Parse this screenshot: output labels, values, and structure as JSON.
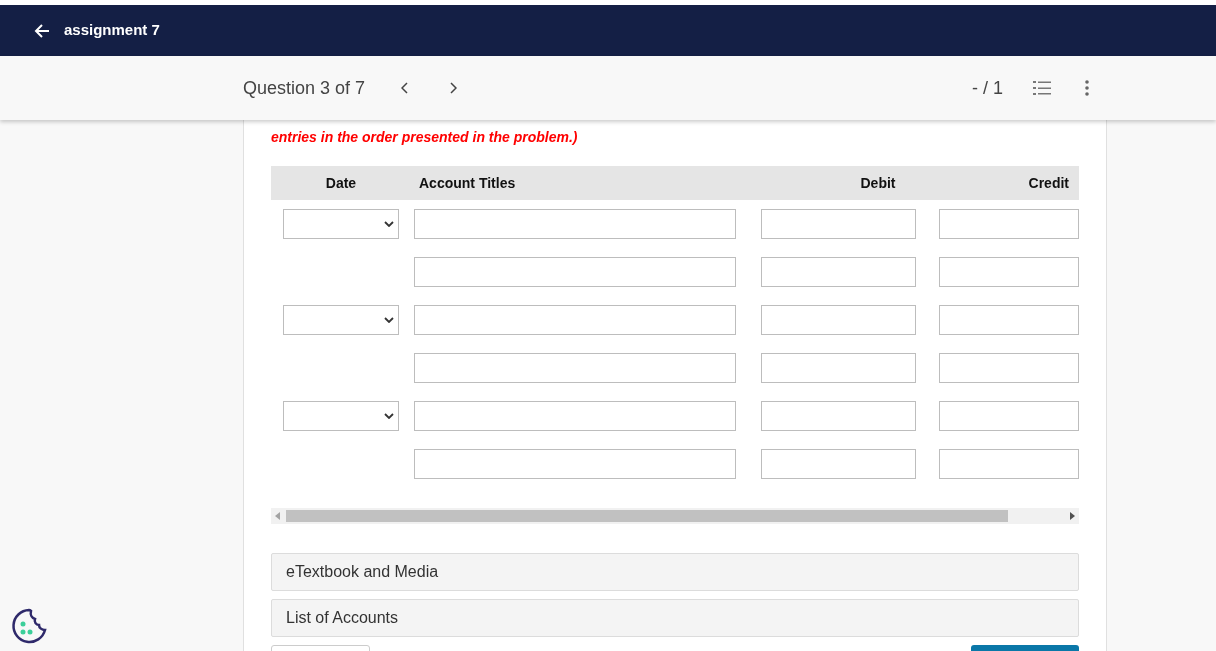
{
  "top_bar": {
    "title": "assignment 7"
  },
  "question_bar": {
    "title": "Question 3 of 7",
    "score": "- / 1"
  },
  "instruction": "entries in the order presented in the problem.)",
  "table": {
    "columns": [
      "Date",
      "Account Titles",
      "Debit",
      "Credit"
    ],
    "rows": [
      {
        "kind": "entry"
      },
      {
        "kind": "line"
      },
      {
        "kind": "entry"
      },
      {
        "kind": "line"
      },
      {
        "kind": "entry"
      },
      {
        "kind": "line"
      }
    ]
  },
  "sections": [
    {
      "title": "eTextbook and Media"
    },
    {
      "title": "List of Accounts"
    }
  ]
}
